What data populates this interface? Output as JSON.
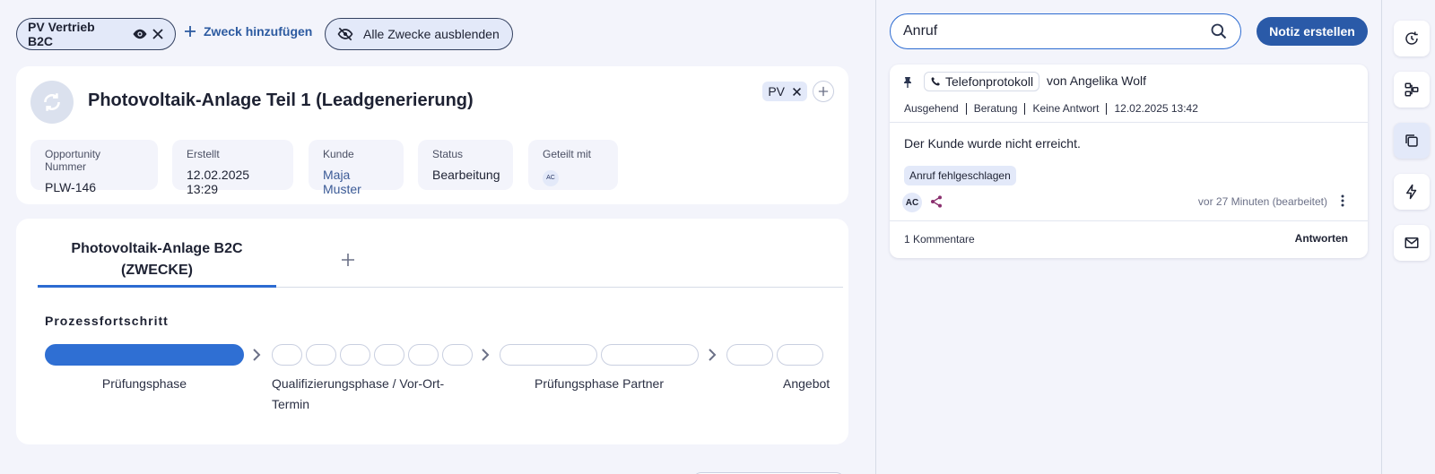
{
  "purpose_bar": {
    "active_purpose": "PV Vertrieb B2C",
    "add_purpose": "Zweck hinzufügen",
    "hide_all": "Alle Zwecke ausblenden"
  },
  "opportunity": {
    "title": "Photovoltaik-Anlage Teil 1 (Leadgenerierung)",
    "tag": "PV",
    "meta": [
      {
        "label": "Opportunity Nummer",
        "value": "PLW-146"
      },
      {
        "label": "Erstellt",
        "value": "12.02.2025 13:29"
      },
      {
        "label": "Kunde",
        "value": "Maja Muster"
      },
      {
        "label": "Status",
        "value": "Bearbeitung"
      },
      {
        "label": "Geteilt mit",
        "value": "AC"
      }
    ]
  },
  "process": {
    "tab_label": "Photovoltaik-Anlage B2C\n(ZWECKE)",
    "title": "Prozessfortschritt",
    "phases": [
      {
        "label": "Prüfungsphase",
        "steps": 1,
        "completed": 1
      },
      {
        "label": "Qualifizierungsphase / Vor-Ort-\nTermin",
        "steps": 6,
        "completed": 0
      },
      {
        "label": "Prüfungsphase Partner",
        "steps": 2,
        "completed": 0
      },
      {
        "label": "Angebot",
        "steps": 2,
        "completed": 0
      }
    ]
  },
  "notes_panel": {
    "search_value": "Anruf",
    "create_button": "Notiz erstellen",
    "note": {
      "type": "Telefonprotokoll",
      "author": "von Angelika Wolf",
      "props": [
        "Ausgehend",
        "Beratung",
        "Keine Antwort",
        "12.02.2025 13:42"
      ],
      "body": "Der Kunde wurde nicht erreicht.",
      "tag": "Anruf fehlgeschlagen",
      "user_initials": "AC",
      "time": "vor 27 Minuten (bearbeitet)",
      "comments": "1 Kommentare",
      "reply": "Antworten"
    }
  },
  "rail": {
    "icons": [
      "history-icon",
      "workflow-icon",
      "notes-icon",
      "lightning-icon",
      "mail-icon"
    ],
    "active": "notes-icon"
  },
  "colors": {
    "accent": "#2c6bd1",
    "primary_button": "#2a5aa8",
    "chip_bg": "#e3e9f9",
    "progress_done": "#2f6fd3"
  }
}
